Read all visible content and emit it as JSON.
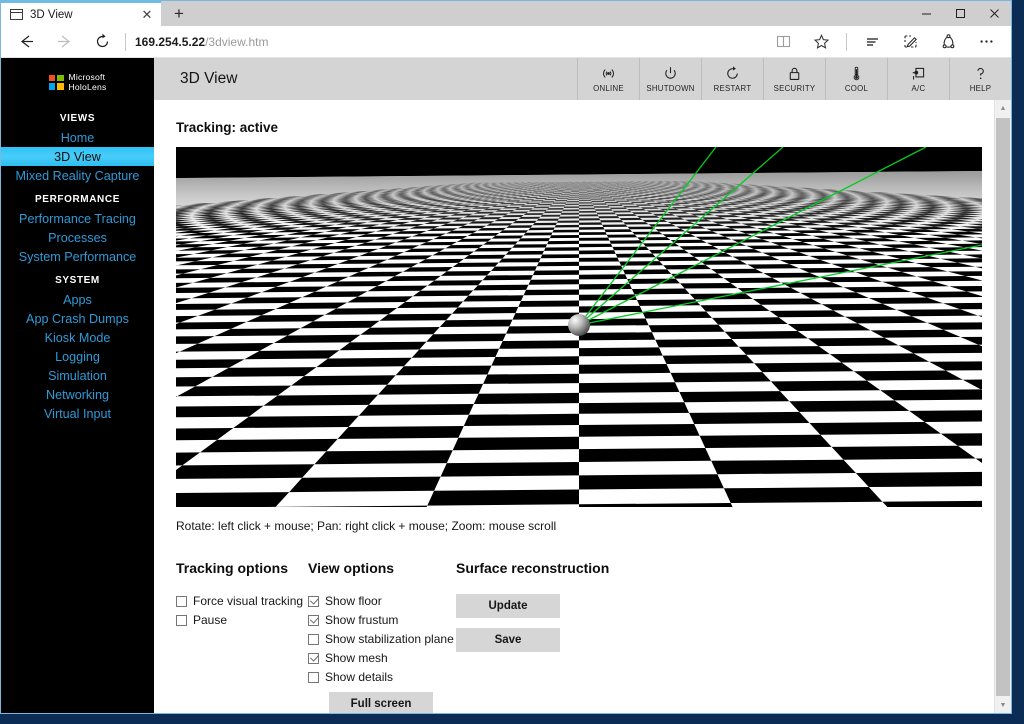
{
  "browser": {
    "tab": {
      "title": "3D View",
      "close_label": "✕",
      "icon": "window-icon"
    },
    "new_tab_label": "+",
    "window_controls": {
      "minimize": "─",
      "maximize": "☐",
      "close": "✕"
    },
    "nav": {
      "back": "←",
      "forward": "→",
      "refresh": "↻",
      "url_host": "169.254.5.22",
      "url_path": "/3dview.htm"
    },
    "toolbar_icons": [
      {
        "name": "reading-list-icon"
      },
      {
        "name": "favorites-star-icon"
      },
      {
        "name": "hub-icon"
      },
      {
        "name": "web-note-icon"
      },
      {
        "name": "share-icon"
      },
      {
        "name": "more-settings-icon"
      }
    ]
  },
  "sidebar": {
    "brand": {
      "line1": "Microsoft",
      "line2": "HoloLens"
    },
    "sections": [
      {
        "header": "VIEWS",
        "items": [
          {
            "label": "Home",
            "active": false
          },
          {
            "label": "3D View",
            "active": true
          },
          {
            "label": "Mixed Reality Capture",
            "active": false
          }
        ]
      },
      {
        "header": "PERFORMANCE",
        "items": [
          {
            "label": "Performance Tracing",
            "active": false
          },
          {
            "label": "Processes",
            "active": false
          },
          {
            "label": "System Performance",
            "active": false
          }
        ]
      },
      {
        "header": "SYSTEM",
        "items": [
          {
            "label": "Apps",
            "active": false
          },
          {
            "label": "App Crash Dumps",
            "active": false
          },
          {
            "label": "Kiosk Mode",
            "active": false
          },
          {
            "label": "Logging",
            "active": false
          },
          {
            "label": "Simulation",
            "active": false
          },
          {
            "label": "Networking",
            "active": false
          },
          {
            "label": "Virtual Input",
            "active": false
          }
        ]
      }
    ]
  },
  "device_bar": {
    "title": "3D View",
    "actions": [
      {
        "label": "ONLINE",
        "icon": "wifi-online-icon"
      },
      {
        "label": "SHUTDOWN",
        "icon": "power-icon"
      },
      {
        "label": "RESTART",
        "icon": "restart-icon"
      },
      {
        "label": "SECURITY",
        "icon": "lock-icon"
      },
      {
        "label": "COOL",
        "icon": "thermometer-icon"
      },
      {
        "label": "A/C",
        "icon": "power-plug-icon"
      },
      {
        "label": "HELP",
        "icon": "question-mark-icon"
      }
    ]
  },
  "main": {
    "tracking_status": "Tracking: active",
    "viewport": {
      "hint": "Rotate: left click + mouse; Pan: right click + mouse; Zoom: mouse scroll",
      "floor_style": "checkerboard",
      "frustum_color": "#00cc22",
      "background_color": "#000000",
      "headset_marker": "gray-sphere"
    },
    "tracking_options": {
      "title": "Tracking options",
      "items": [
        {
          "label": "Force visual tracking",
          "checked": false
        },
        {
          "label": "Pause",
          "checked": false
        }
      ]
    },
    "view_options": {
      "title": "View options",
      "items": [
        {
          "label": "Show floor",
          "checked": true
        },
        {
          "label": "Show frustum",
          "checked": true
        },
        {
          "label": "Show stabilization plane",
          "checked": false
        },
        {
          "label": "Show mesh",
          "checked": true
        },
        {
          "label": "Show details",
          "checked": false
        }
      ],
      "fullscreen_label": "Full screen"
    },
    "surface_reconstruction": {
      "title": "Surface reconstruction",
      "update_label": "Update",
      "save_label": "Save"
    }
  },
  "scrollbar": {
    "up": "▲",
    "down": "▼"
  }
}
